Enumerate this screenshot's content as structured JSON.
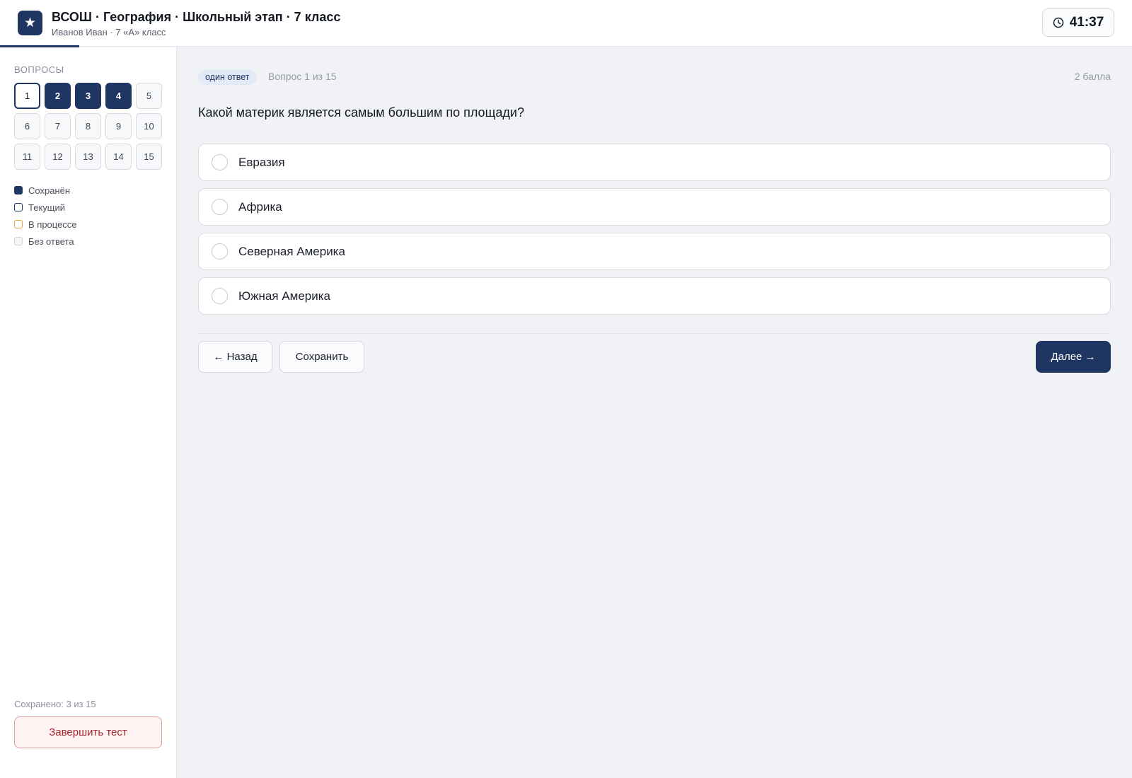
{
  "header": {
    "logo_icon": "star-icon",
    "title": "ВСОШ · География · Школьный этап · 7 класс",
    "subtitle": "Иванов Иван · 7 «А» класс",
    "timer_icon": "clock-icon",
    "timer": "41:37",
    "progress_fraction": 0.07
  },
  "sidebar": {
    "heading": "Вопросы",
    "questions": [
      {
        "number": "1",
        "state": "current"
      },
      {
        "number": "2",
        "state": "saved"
      },
      {
        "number": "3",
        "state": "saved"
      },
      {
        "number": "4",
        "state": "saved"
      },
      {
        "number": "5",
        "state": "empty"
      },
      {
        "number": "6",
        "state": "empty"
      },
      {
        "number": "7",
        "state": "empty"
      },
      {
        "number": "8",
        "state": "empty"
      },
      {
        "number": "9",
        "state": "empty"
      },
      {
        "number": "10",
        "state": "empty"
      },
      {
        "number": "11",
        "state": "empty"
      },
      {
        "number": "12",
        "state": "empty"
      },
      {
        "number": "13",
        "state": "empty"
      },
      {
        "number": "14",
        "state": "empty"
      },
      {
        "number": "15",
        "state": "empty"
      }
    ],
    "legend": [
      {
        "label": "Сохранён",
        "state": "saved"
      },
      {
        "label": "Текущий",
        "state": "current"
      },
      {
        "label": "В процессе",
        "state": "progress"
      },
      {
        "label": "Без ответа",
        "state": "empty"
      }
    ],
    "saved_count": "Сохранено: 3 из 15",
    "finish_label": "Завершить тест"
  },
  "main": {
    "badge": "один ответ",
    "question_counter": "Вопрос 1 из 15",
    "points": "2 балла",
    "question": "Какой материк является самым большим по площади?",
    "options": [
      {
        "label": "Евразия",
        "selected": false
      },
      {
        "label": "Африка",
        "selected": false
      },
      {
        "label": "Северная Америка",
        "selected": false
      },
      {
        "label": "Южная Америка",
        "selected": false
      }
    ],
    "back_label": "← Назад",
    "save_label": "Сохранить",
    "next_label": "Далее →"
  },
  "colors": {
    "accent": "#1f3562",
    "in_progress": "#e6a23c",
    "danger": "#a4262c",
    "background": "#f0f2f6"
  }
}
